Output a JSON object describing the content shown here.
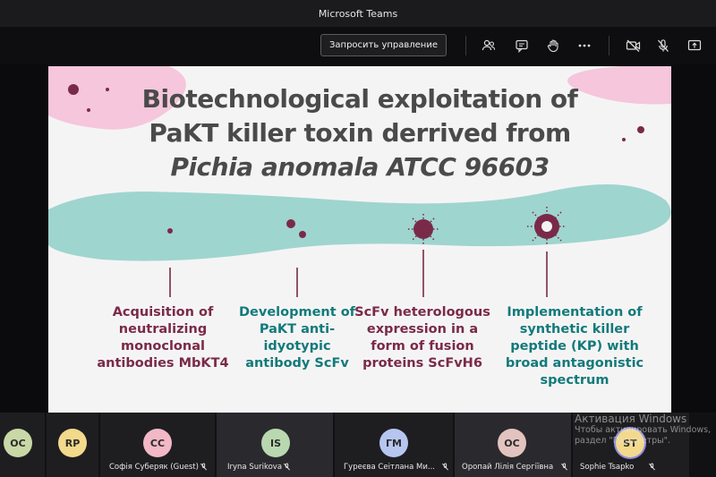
{
  "window": {
    "title": "Microsoft Teams"
  },
  "toolbar": {
    "request_control_label": "Запросить управление",
    "icons": [
      "people-icon",
      "chat-icon",
      "raise-hand-icon",
      "more-icon",
      "camera-off-icon",
      "mic-off-icon",
      "share-screen-icon"
    ]
  },
  "slide": {
    "title_line1": "Biotechnological exploitation of",
    "title_line2": "PaKT killer toxin derrived from",
    "title_line3": "Pichia anomala ATCC 96603",
    "columns": [
      {
        "text": "Acquisition of neutralizing monoclonal antibodies MbKT4"
      },
      {
        "text": "Development of PaKT anti-idyotypic antibody ScFv"
      },
      {
        "text": "ScFv heterologous expression in a form of fusion proteins ScFvH6"
      },
      {
        "text": "Implementation of synthetic killer peptide (KP) with broad antagonistic spectrum"
      }
    ],
    "colors": {
      "maroon": "#7a2a49",
      "teal": "#127a7c",
      "mint": "#9fd5cf",
      "pink": "#f5c6dc"
    }
  },
  "participants": [
    {
      "initials": "OC",
      "name": "",
      "color": "#c9d8a6"
    },
    {
      "initials": "RP",
      "name": "",
      "color": "#f3d98c"
    },
    {
      "initials": "CC",
      "name": "Софія Суберяк (Guest)",
      "color": "#f2b8c6"
    },
    {
      "initials": "IS",
      "name": "Iryna Surikova",
      "color": "#b9d8b0"
    },
    {
      "initials": "ГМ",
      "name": "Гуреєва Сеітлана Ми...",
      "color": "#b7c6f0"
    },
    {
      "initials": "OC",
      "name": "Оропай Лілія Сергіївна",
      "color": "#e3c3bf"
    },
    {
      "initials": "ST",
      "name": "Sophie Tsapko",
      "color": "#f3d98c"
    }
  ],
  "watermark": {
    "line1": "Активация Windows",
    "line2": "Чтобы активировать Windows,",
    "line3": "раздел \"Параметры\"."
  }
}
